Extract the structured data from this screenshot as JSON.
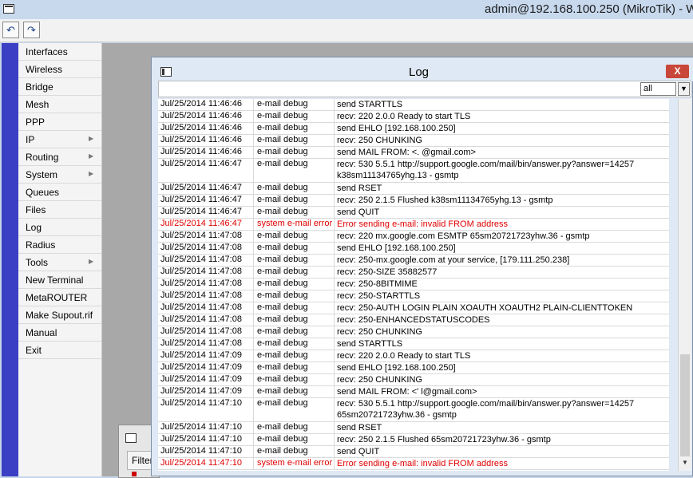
{
  "app": {
    "title": "admin@192.168.100.250 (MikroTik) - W"
  },
  "toolbar": {
    "undo_icon": "undo-icon",
    "redo_icon": "redo-icon",
    "undo_glyph": "↶",
    "redo_glyph": "↷"
  },
  "menu": {
    "items": [
      {
        "label": "Interfaces",
        "submenu": false
      },
      {
        "label": "Wireless",
        "submenu": false
      },
      {
        "label": "Bridge",
        "submenu": false
      },
      {
        "label": "Mesh",
        "submenu": false
      },
      {
        "label": "PPP",
        "submenu": false
      },
      {
        "label": "IP",
        "submenu": true
      },
      {
        "label": "Routing",
        "submenu": true
      },
      {
        "label": "System",
        "submenu": true
      },
      {
        "label": "Queues",
        "submenu": false
      },
      {
        "label": "Files",
        "submenu": false
      },
      {
        "label": "Log",
        "submenu": false
      },
      {
        "label": "Radius",
        "submenu": false
      },
      {
        "label": "Tools",
        "submenu": true
      },
      {
        "label": "New Terminal",
        "submenu": false
      },
      {
        "label": "MetaROUTER",
        "submenu": false
      },
      {
        "label": "Make Supout.rif",
        "submenu": false
      },
      {
        "label": "Manual",
        "submenu": false
      },
      {
        "label": "Exit",
        "submenu": false
      }
    ]
  },
  "background_window": {
    "filter_label": "Filter"
  },
  "log_window": {
    "title": "Log",
    "close_glyph": "X",
    "filter_value": "all",
    "dropdown_glyph": "▼",
    "error_color": "#e00000",
    "rows": [
      {
        "time": "Jul/25/2014 11:46:46",
        "topic": "e-mail debug",
        "message": [
          "send STARTTLS"
        ]
      },
      {
        "time": "Jul/25/2014 11:46:46",
        "topic": "e-mail debug",
        "message": [
          "recv: 220 2.0.0 Ready to start TLS"
        ]
      },
      {
        "time": "Jul/25/2014 11:46:46",
        "topic": "e-mail debug",
        "message": [
          "send EHLO [192.168.100.250]"
        ]
      },
      {
        "time": "Jul/25/2014 11:46:46",
        "topic": "e-mail debug",
        "message": [
          "recv: 250 CHUNKING"
        ]
      },
      {
        "time": "Jul/25/2014 11:46:46",
        "topic": "e-mail debug",
        "message": [
          "send MAIL FROM: <.          @gmail.com>"
        ]
      },
      {
        "time": "Jul/25/2014 11:46:47",
        "topic": "e-mail debug",
        "message": [
          "recv: 530 5.5.1 http://support.google.com/mail/bin/answer.py?answer=14257",
          "k38sm11134765yhg.13 - gsmtp"
        ]
      },
      {
        "time": "Jul/25/2014 11:46:47",
        "topic": "e-mail debug",
        "message": [
          "send RSET"
        ]
      },
      {
        "time": "Jul/25/2014 11:46:47",
        "topic": "e-mail debug",
        "message": [
          "recv: 250 2.1.5 Flushed k38sm11134765yhg.13 - gsmtp"
        ]
      },
      {
        "time": "Jul/25/2014 11:46:47",
        "topic": "e-mail debug",
        "message": [
          "send QUIT"
        ]
      },
      {
        "time": "Jul/25/2014 11:46:47",
        "topic": "system e-mail error",
        "message": [
          "Error sending e-mail: invalid FROM address"
        ],
        "error": true
      },
      {
        "time": "Jul/25/2014 11:47:08",
        "topic": "e-mail debug",
        "message": [
          "recv: 220 mx.google.com ESMTP 65sm20721723yhw.36 - gsmtp"
        ]
      },
      {
        "time": "Jul/25/2014 11:47:08",
        "topic": "e-mail debug",
        "message": [
          "send EHLO [192.168.100.250]"
        ]
      },
      {
        "time": "Jul/25/2014 11:47:08",
        "topic": "e-mail debug",
        "message": [
          "recv: 250-mx.google.com at your service, [179.111.250.238]"
        ]
      },
      {
        "time": "Jul/25/2014 11:47:08",
        "topic": "e-mail debug",
        "message": [
          "recv: 250-SIZE 35882577"
        ]
      },
      {
        "time": "Jul/25/2014 11:47:08",
        "topic": "e-mail debug",
        "message": [
          "recv: 250-8BITMIME"
        ]
      },
      {
        "time": "Jul/25/2014 11:47:08",
        "topic": "e-mail debug",
        "message": [
          "recv: 250-STARTTLS"
        ]
      },
      {
        "time": "Jul/25/2014 11:47:08",
        "topic": "e-mail debug",
        "message": [
          "recv: 250-AUTH LOGIN PLAIN XOAUTH XOAUTH2 PLAIN-CLIENTTOKEN"
        ]
      },
      {
        "time": "Jul/25/2014 11:47:08",
        "topic": "e-mail debug",
        "message": [
          "recv: 250-ENHANCEDSTATUSCODES"
        ]
      },
      {
        "time": "Jul/25/2014 11:47:08",
        "topic": "e-mail debug",
        "message": [
          "recv: 250 CHUNKING"
        ]
      },
      {
        "time": "Jul/25/2014 11:47:08",
        "topic": "e-mail debug",
        "message": [
          "send STARTTLS"
        ]
      },
      {
        "time": "Jul/25/2014 11:47:09",
        "topic": "e-mail debug",
        "message": [
          "recv: 220 2.0.0 Ready to start TLS"
        ]
      },
      {
        "time": "Jul/25/2014 11:47:09",
        "topic": "e-mail debug",
        "message": [
          "send EHLO [192.168.100.250]"
        ]
      },
      {
        "time": "Jul/25/2014 11:47:09",
        "topic": "e-mail debug",
        "message": [
          "recv: 250 CHUNKING"
        ]
      },
      {
        "time": "Jul/25/2014 11:47:09",
        "topic": "e-mail debug",
        "message": [
          "send MAIL FROM: <'        l@gmail.com>"
        ]
      },
      {
        "time": "Jul/25/2014 11:47:10",
        "topic": "e-mail debug",
        "message": [
          "recv: 530 5.5.1 http://support.google.com/mail/bin/answer.py?answer=14257",
          "65sm20721723yhw.36 - gsmtp"
        ]
      },
      {
        "time": "Jul/25/2014 11:47:10",
        "topic": "e-mail debug",
        "message": [
          "send RSET"
        ]
      },
      {
        "time": "Jul/25/2014 11:47:10",
        "topic": "e-mail debug",
        "message": [
          "recv: 250 2.1.5 Flushed 65sm20721723yhw.36 - gsmtp"
        ]
      },
      {
        "time": "Jul/25/2014 11:47:10",
        "topic": "e-mail debug",
        "message": [
          "send QUIT"
        ]
      },
      {
        "time": "Jul/25/2014 11:47:10",
        "topic": "system e-mail error",
        "message": [
          "Error sending e-mail: invalid FROM address"
        ],
        "error": true
      }
    ]
  }
}
